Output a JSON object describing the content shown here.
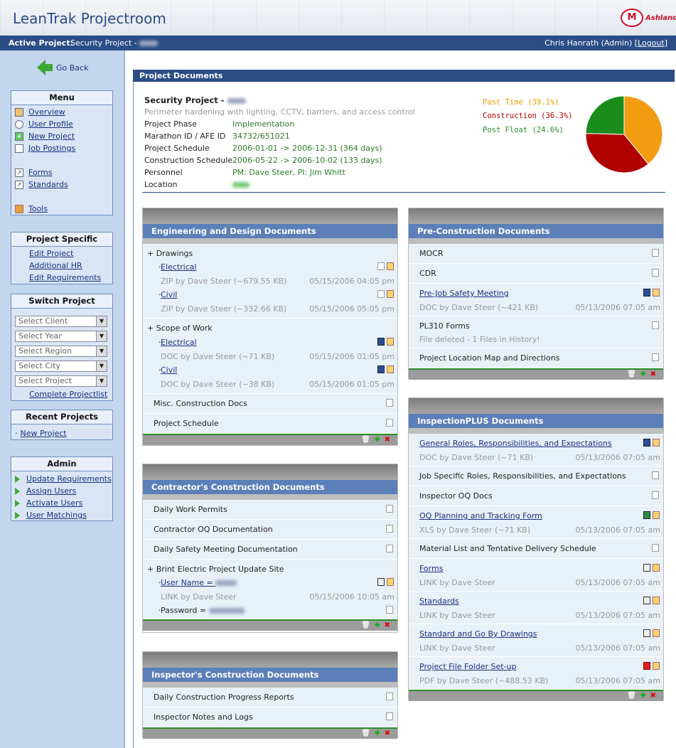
{
  "header": {
    "app_title": "LeanTrak Projectroom",
    "logo1": "M",
    "logo2": "Ashland"
  },
  "topbar": {
    "active_label": "Active Project:",
    "active_value": "Security Project - ",
    "user": "Chris Hanrath (Admin) [",
    "logout": "Logout",
    "close_bracket": "]"
  },
  "sidebar": {
    "go_back": "Go Back",
    "menu": {
      "title": "Menu",
      "items": [
        "Overview",
        "User Profile",
        "New Project",
        "Job Postings",
        "Forms",
        "Standards",
        "Tools"
      ]
    },
    "project_specific": {
      "title": "Project Specific",
      "items": [
        "Edit Project",
        "Additional HR",
        "Edit Requirements"
      ]
    },
    "switch_project": {
      "title": "Switch Project",
      "selects": [
        "Select Client",
        "Select Year",
        "Select Region",
        "Select City",
        "Select Project"
      ],
      "link": "Complete Projectlist"
    },
    "recent": {
      "title": "Recent Projects",
      "items": [
        "New Project"
      ]
    },
    "admin": {
      "title": "Admin",
      "items": [
        "Update Requirements",
        "Assign Users",
        "Activate Users",
        "User Matchings"
      ]
    }
  },
  "main": {
    "section_title": "Project Documents",
    "project_name": "Security Project - ",
    "project_desc": "Perimeter hardening with lighting, CCTV, barriers, and access control",
    "info": [
      {
        "label": "Project Phase",
        "value": "Implementation"
      },
      {
        "label": "Marathon ID / AFE ID",
        "value": "34732/651021"
      },
      {
        "label": "Project Schedule",
        "value": "2006-01-01 -> 2006-12-31 (364 days)"
      },
      {
        "label": "Construction Schedule",
        "value": "2006-05-22 -> 2006-10-02 (133 days)"
      },
      {
        "label": "Personnel",
        "value": "PM: Dave Steer, PI: Jim Whitt"
      },
      {
        "label": "Location",
        "value": ""
      }
    ],
    "legend": [
      {
        "label": "Past Time (39.1%)",
        "color": "#e8a000"
      },
      {
        "label": "Construction (36.3%)",
        "color": "#b00000"
      },
      {
        "label": "Post Float (24.6%)",
        "color": "#2a8d2a"
      }
    ],
    "chart_data": {
      "type": "pie",
      "categories": [
        "Past Time",
        "Construction",
        "Post Float"
      ],
      "values": [
        39.1,
        36.3,
        24.6
      ],
      "colors": [
        "#f39c12",
        "#b00000",
        "#1a8c1a"
      ]
    }
  },
  "panels": {
    "eng": {
      "title": "Engineering and Design Documents",
      "drawings": "+ Drawings",
      "electrical": "Electrical",
      "elec_meta": "ZIP by Dave Steer (~679.55 KB)",
      "elec_date": "05/15/2006 04:05 pm",
      "civil": "Civil",
      "civil_meta": "ZIP by Dave Steer (~332.66 KB)",
      "civil_date": "05/15/2006 05:05 pm",
      "scope": "+ Scope of Work",
      "s_elec": "Electrical",
      "s_elec_meta": "DOC by Dave Steer (~71 KB)",
      "s_elec_date": "05/15/2006 01:05 pm",
      "s_civil": "Civil",
      "s_civil_meta": "DOC by Dave Steer (~38 KB)",
      "s_civil_date": "05/15/2006 01:05 pm",
      "misc": "Misc. Construction Docs",
      "sched": "Project Schedule"
    },
    "contractor": {
      "title": "Contractor's Construction Documents",
      "r1": "Daily Work Permits",
      "r2": "Contractor OQ Documentation",
      "r3": "Daily Safety Meeting Documentation",
      "r4": "+ Brint Electric Project Update Site",
      "user": "User Name = ",
      "user_meta": "LINK by Dave Steer",
      "user_date": "05/15/2006 10:05 am",
      "pass": "Password = "
    },
    "inspector": {
      "title": "Inspector's Construction Documents",
      "r1": "Daily Construction Progress Reports",
      "r2": "Inspector Notes and Logs"
    },
    "precon": {
      "title": "Pre-Construction Documents",
      "r1": "MOCR",
      "r2": "CDR",
      "r3": "Pre-Job Safety Meeting",
      "r3_meta": "DOC by Dave Steer (~421 KB)",
      "r3_date": "05/13/2006 07:05 am",
      "r4": "PL310 Forms",
      "r4_meta": "File deleted - 1 Files in History!",
      "r5": "Project Location Map and Directions"
    },
    "insp_plus": {
      "title": "InspectionPLUS Documents",
      "r1": "General Roles, Responsibilities, and Expectations",
      "r1_meta": "DOC by Dave Steer (~71 KB)",
      "r1_date": "05/13/2006 07:05 am",
      "r2": "Job Specific Roles, Responsibilities, and Expectations",
      "r3": "Inspector OQ Docs",
      "r4": "OQ Planning and Tracking Form",
      "r4_meta": "XLS by Dave Steer (~71 KB)",
      "r4_date": "05/13/2006 07:05 am",
      "r5": "Material List and Tentative Delivery Schedule",
      "r6": "Forms",
      "r6_meta": "LINK by Dave Steer",
      "r6_date": "05/13/2006 07:05 am",
      "r7": "Standards",
      "r7_meta": "LINK by Dave Steer",
      "r7_date": "05/13/2006 07:05 am",
      "r8": "Standard and Go By Drawings",
      "r8_meta": "LINK by Dave Steer",
      "r8_date": "05/13/2006 07:05 am",
      "r9": "Project File Folder Set-up",
      "r9_meta": "PDF by Dave Steer (~488.53 KB)",
      "r9_date": "05/13/2006 07:05 am"
    }
  }
}
